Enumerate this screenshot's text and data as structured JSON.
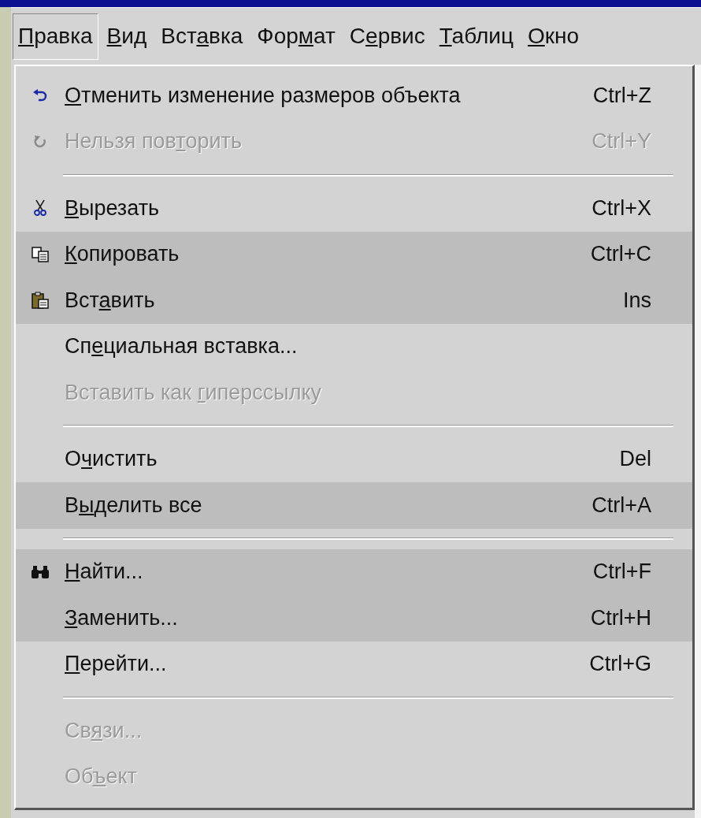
{
  "menu_bar": [
    {
      "label": "Правка",
      "selected": true
    },
    {
      "label": "Вид",
      "selected": false
    },
    {
      "label": "Вставка",
      "selected": false
    },
    {
      "label": "Формат",
      "selected": false
    },
    {
      "label": "Сервис",
      "selected": false
    },
    {
      "label": "Таблиц",
      "selected": false
    },
    {
      "label": "Окно",
      "selected": false
    }
  ],
  "menu": [
    {
      "kind": "item",
      "label": "Отменить изменение размеров объекта",
      "shortcut": "Ctrl+Z",
      "disabled": false,
      "highlighted": false
    },
    {
      "kind": "item",
      "label": "Нельзя повторить",
      "shortcut": "Ctrl+Y",
      "disabled": true,
      "highlighted": false
    },
    {
      "kind": "separator"
    },
    {
      "kind": "item",
      "label": "Вырезать",
      "shortcut": "Ctrl+X",
      "disabled": false,
      "highlighted": false
    },
    {
      "kind": "item",
      "label": "Копировать",
      "shortcut": "Ctrl+C",
      "disabled": false,
      "highlighted": true
    },
    {
      "kind": "item",
      "label": "Вставить",
      "shortcut": "Ins",
      "disabled": false,
      "highlighted": true
    },
    {
      "kind": "item",
      "label": "Специальная вставка...",
      "disabled": false,
      "highlighted": false
    },
    {
      "kind": "item",
      "label": "Вставить как гиперссылку",
      "disabled": true,
      "highlighted": false
    },
    {
      "kind": "separator"
    },
    {
      "kind": "item",
      "label": "Очистить",
      "shortcut": "Del",
      "disabled": false,
      "highlighted": false
    },
    {
      "kind": "item",
      "label": "Выделить все",
      "shortcut": "Ctrl+A",
      "disabled": false,
      "highlighted": true
    },
    {
      "kind": "separator"
    },
    {
      "kind": "item",
      "label": "Найти...",
      "shortcut": "Ctrl+F",
      "disabled": false,
      "highlighted": true
    },
    {
      "kind": "item",
      "label": "Заменить...",
      "shortcut": "Ctrl+H",
      "disabled": false,
      "highlighted": true
    },
    {
      "kind": "item",
      "label": "Перейти...",
      "shortcut": "Ctrl+G",
      "disabled": false,
      "highlighted": false
    },
    {
      "kind": "separator"
    },
    {
      "kind": "item",
      "label": "Связи...",
      "disabled": true,
      "highlighted": false
    },
    {
      "kind": "item",
      "label": "Объект",
      "disabled": true,
      "highlighted": false
    }
  ]
}
